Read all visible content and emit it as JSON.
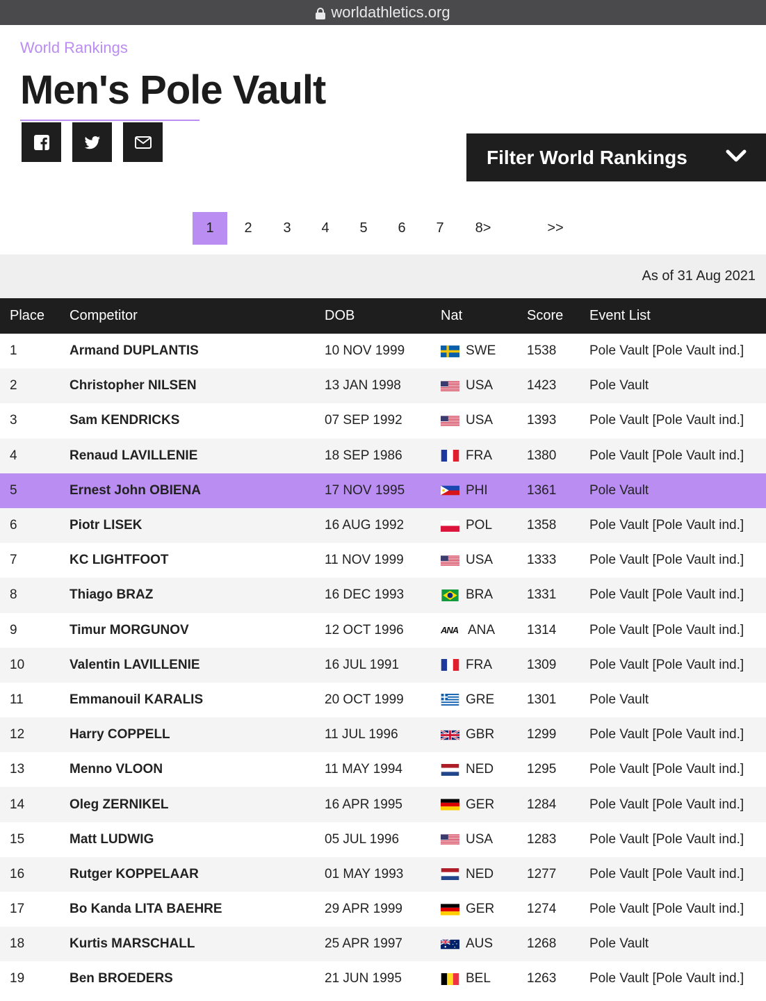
{
  "browser": {
    "url": "worldathletics.org"
  },
  "header": {
    "kicker": "World Rankings",
    "title": "Men's Pole Vault"
  },
  "share": [
    {
      "icon": "facebook-icon"
    },
    {
      "icon": "twitter-icon"
    },
    {
      "icon": "email-icon"
    }
  ],
  "filter": {
    "label": "Filter World Rankings",
    "icon": "chevron-down-icon"
  },
  "pagination": {
    "pages": [
      "1",
      "2",
      "3",
      "4",
      "5",
      "6",
      "7",
      "8>",
      ">>"
    ],
    "current": "1"
  },
  "as_of": "As of 31 Aug 2021",
  "colors": {
    "accent": "#b98df2",
    "dark": "#1e1e1e",
    "stripe": "#f4f4f4"
  },
  "table": {
    "headers": [
      "Place",
      "Competitor",
      "DOB",
      "Nat",
      "Score",
      "Event List"
    ],
    "rows": [
      {
        "place": "1",
        "competitor": "Armand DUPLANTIS",
        "dob": "10 NOV 1999",
        "nat": "SWE",
        "score": "1538",
        "events": "Pole Vault [Pole Vault ind.]"
      },
      {
        "place": "2",
        "competitor": "Christopher NILSEN",
        "dob": "13 JAN 1998",
        "nat": "USA",
        "score": "1423",
        "events": "Pole Vault"
      },
      {
        "place": "3",
        "competitor": "Sam KENDRICKS",
        "dob": "07 SEP 1992",
        "nat": "USA",
        "score": "1393",
        "events": "Pole Vault [Pole Vault ind.]"
      },
      {
        "place": "4",
        "competitor": "Renaud LAVILLENIE",
        "dob": "18 SEP 1986",
        "nat": "FRA",
        "score": "1380",
        "events": "Pole Vault [Pole Vault ind.]"
      },
      {
        "place": "5",
        "competitor": "Ernest John OBIENA",
        "dob": "17 NOV 1995",
        "nat": "PHI",
        "score": "1361",
        "events": "Pole Vault",
        "highlighted": true
      },
      {
        "place": "6",
        "competitor": "Piotr LISEK",
        "dob": "16 AUG 1992",
        "nat": "POL",
        "score": "1358",
        "events": "Pole Vault [Pole Vault ind.]"
      },
      {
        "place": "7",
        "competitor": "KC LIGHTFOOT",
        "dob": "11 NOV 1999",
        "nat": "USA",
        "score": "1333",
        "events": "Pole Vault [Pole Vault ind.]"
      },
      {
        "place": "8",
        "competitor": "Thiago BRAZ",
        "dob": "16 DEC 1993",
        "nat": "BRA",
        "score": "1331",
        "events": "Pole Vault [Pole Vault ind.]"
      },
      {
        "place": "9",
        "competitor": "Timur MORGUNOV",
        "dob": "12 OCT 1996",
        "nat": "ANA",
        "score": "1314",
        "events": "Pole Vault [Pole Vault ind.]",
        "flag_text": "ANA"
      },
      {
        "place": "10",
        "competitor": "Valentin LAVILLENIE",
        "dob": "16 JUL 1991",
        "nat": "FRA",
        "score": "1309",
        "events": "Pole Vault [Pole Vault ind.]"
      },
      {
        "place": "11",
        "competitor": "Emmanouil KARALIS",
        "dob": "20 OCT 1999",
        "nat": "GRE",
        "score": "1301",
        "events": "Pole Vault"
      },
      {
        "place": "12",
        "competitor": "Harry COPPELL",
        "dob": "11 JUL 1996",
        "nat": "GBR",
        "score": "1299",
        "events": "Pole Vault [Pole Vault ind.]"
      },
      {
        "place": "13",
        "competitor": "Menno VLOON",
        "dob": "11 MAY 1994",
        "nat": "NED",
        "score": "1295",
        "events": "Pole Vault [Pole Vault ind.]"
      },
      {
        "place": "14",
        "competitor": "Oleg ZERNIKEL",
        "dob": "16 APR 1995",
        "nat": "GER",
        "score": "1284",
        "events": "Pole Vault [Pole Vault ind.]"
      },
      {
        "place": "15",
        "competitor": "Matt LUDWIG",
        "dob": "05 JUL 1996",
        "nat": "USA",
        "score": "1283",
        "events": "Pole Vault [Pole Vault ind.]"
      },
      {
        "place": "16",
        "competitor": "Rutger KOPPELAAR",
        "dob": "01 MAY 1993",
        "nat": "NED",
        "score": "1277",
        "events": "Pole Vault [Pole Vault ind.]"
      },
      {
        "place": "17",
        "competitor": "Bo Kanda LITA BAEHRE",
        "dob": "29 APR 1999",
        "nat": "GER",
        "score": "1274",
        "events": "Pole Vault [Pole Vault ind.]"
      },
      {
        "place": "18",
        "competitor": "Kurtis MARSCHALL",
        "dob": "25 APR 1997",
        "nat": "AUS",
        "score": "1268",
        "events": "Pole Vault"
      },
      {
        "place": "19",
        "competitor": "Ben BROEDERS",
        "dob": "21 JUN 1995",
        "nat": "BEL",
        "score": "1263",
        "events": "Pole Vault [Pole Vault ind.]"
      }
    ]
  }
}
